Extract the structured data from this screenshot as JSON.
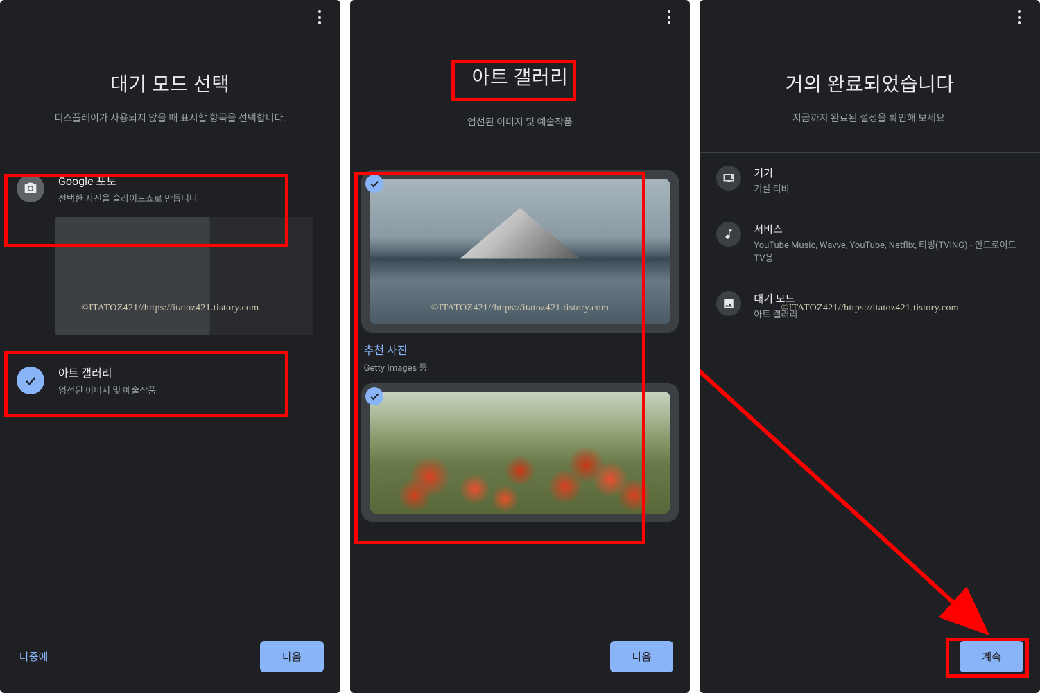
{
  "watermark": "©ITATOZ421//https://itatoz421.tistory.com",
  "panel1": {
    "title": "대기 모드 선택",
    "subtitle": "디스플레이가 사용되지 않을 때 표시할 항목을 선택합니다.",
    "option1": {
      "title": "Google 포토",
      "desc": "선택한 사진을 슬라이드쇼로 만듭니다"
    },
    "option2": {
      "title": "아트 갤러리",
      "desc": "엄선된 이미지 및 예술작품"
    },
    "later": "나중에",
    "next": "다음"
  },
  "panel2": {
    "title": "아트 갤러리",
    "subtitle": "엄선된 이미지 및 예술작품",
    "gallery1": {
      "label": "추천 사진",
      "sub": "Getty Images 등"
    },
    "next": "다음"
  },
  "panel3": {
    "title": "거의 완료되었습니다",
    "subtitle": "지금까지 완료된 설정을 확인해 보세요.",
    "items": [
      {
        "title": "기기",
        "desc": "거실 티비"
      },
      {
        "title": "서비스",
        "desc": "YouTube Music, Wavve, YouTube, Netflix, 티빙(TVING) - 안드로이드TV용"
      },
      {
        "title": "대기 모드",
        "desc": "아트 갤러리"
      }
    ],
    "continue": "계속"
  }
}
